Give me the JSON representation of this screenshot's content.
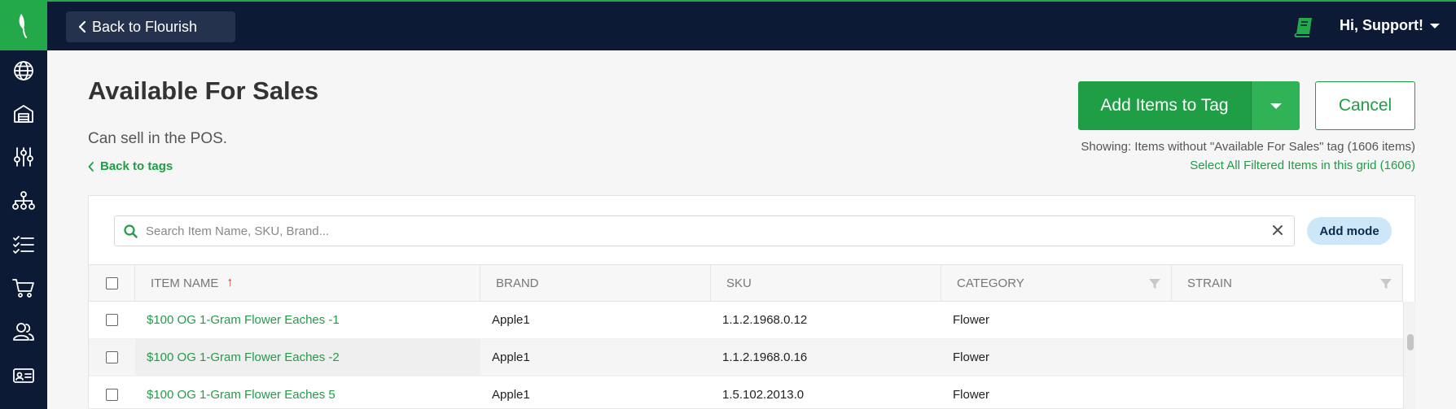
{
  "sidebar": {
    "items": [
      {
        "name": "globe-icon"
      },
      {
        "name": "warehouse-icon"
      },
      {
        "name": "sliders-icon"
      },
      {
        "name": "org-chart-icon"
      },
      {
        "name": "checklist-icon"
      },
      {
        "name": "cart-icon"
      },
      {
        "name": "users-icon"
      },
      {
        "name": "id-card-icon"
      }
    ]
  },
  "topbar": {
    "back_label": "Back to Flourish",
    "user_greeting": "Hi, Support!"
  },
  "header": {
    "title": "Available For Sales",
    "subtitle": "Can sell in the POS.",
    "back_to_tags": "Back to tags",
    "add_items_label": "Add Items to Tag",
    "cancel_label": "Cancel",
    "showing_text": "Showing: Items without \"Available For Sales\" tag (1606 items)",
    "select_all_text": "Select All Filtered Items in this grid (1606)"
  },
  "search": {
    "placeholder": "Search Item Name, SKU, Brand...",
    "value": "",
    "add_mode_label": "Add mode"
  },
  "grid": {
    "columns": {
      "item_name": "ITEM NAME",
      "brand": "BRAND",
      "sku": "SKU",
      "category": "CATEGORY",
      "strain": "STRAIN"
    },
    "sort": {
      "column": "item_name",
      "direction": "ascending"
    },
    "rows": [
      {
        "item_name": "$100 OG 1-Gram Flower Eaches -1",
        "brand": "Apple1",
        "sku": "1.1.2.1968.0.12",
        "category": "Flower",
        "strain": ""
      },
      {
        "item_name": "$100 OG 1-Gram Flower Eaches -2",
        "brand": "Apple1",
        "sku": "1.1.2.1968.0.16",
        "category": "Flower",
        "strain": ""
      },
      {
        "item_name": "$100 OG 1-Gram Flower Eaches 5",
        "brand": "Apple1",
        "sku": "1.5.102.2013.0",
        "category": "Flower",
        "strain": ""
      }
    ]
  },
  "colors": {
    "brand_green": "#1f9e46",
    "nav_dark": "#0c1a36",
    "add_mode_bg": "#cde6f8",
    "sort_arrow": "#e03030"
  }
}
